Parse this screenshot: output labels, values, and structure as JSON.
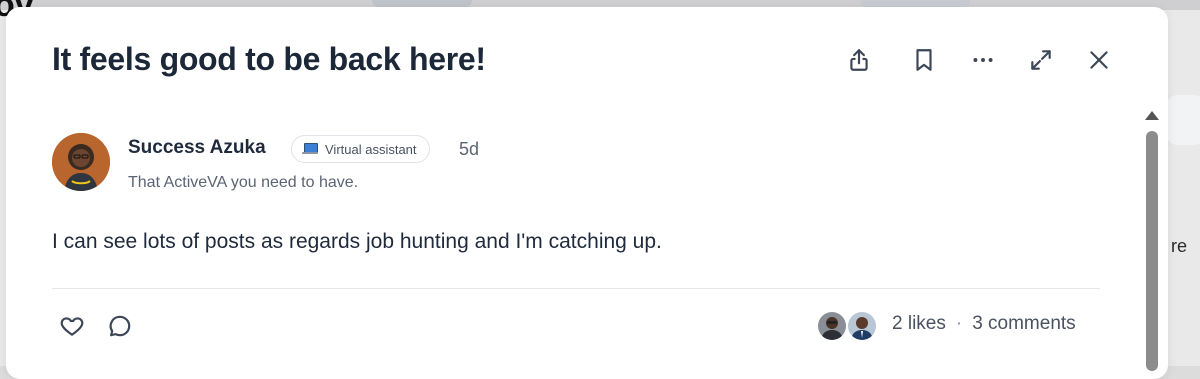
{
  "post": {
    "title": "It feels good to be back here!",
    "author": {
      "name": "Success Azuka",
      "badge": "Virtual assistant",
      "badge_icon": "laptop-icon",
      "time": "5d",
      "tagline": "That ActiveVA you need to have."
    },
    "body": "I can see lots of posts as regards job hunting and I'm catching up.",
    "likes": "2 likes",
    "separator": "·",
    "comments": "3 comments"
  },
  "actions": [
    "share-icon",
    "bookmark-icon",
    "more-icon",
    "expand-icon",
    "close-icon"
  ],
  "background": {
    "right_text": "re"
  },
  "colors": {
    "title": "#1c2738",
    "text": "#1f2a3c",
    "muted": "#5b6474",
    "badge_border": "#dfe2e7",
    "divider": "#e6e8ec"
  }
}
